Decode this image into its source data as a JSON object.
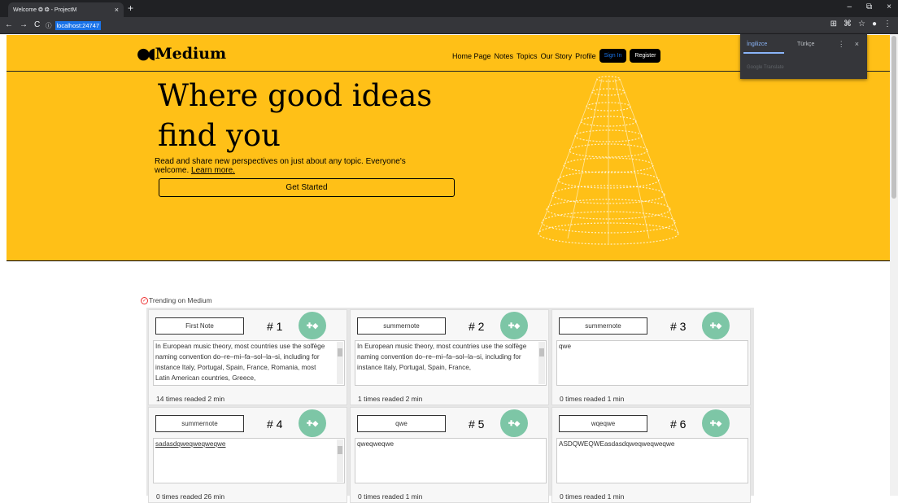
{
  "browser": {
    "tab_title": "Welcome ❂ ❂ - ProjectM",
    "tab_close": "×",
    "new_tab": "+",
    "url": "localhost:24747",
    "back": "←",
    "fwd": "→",
    "reload": "C",
    "info": "ⓘ",
    "min": "–",
    "restore": "⧉",
    "close": "×",
    "ext1": "⊞",
    "ext2": "⌘",
    "star": "☆",
    "profile": "●",
    "menu": "⋮"
  },
  "translate": {
    "lang_en": "İngilizce",
    "lang_tr": "Türkçe",
    "footer": "Google Translate",
    "more": "⋮",
    "close": "×"
  },
  "nav": {
    "brand": "Medium",
    "brand_mark": "●◖",
    "links": [
      "Home Page",
      "Notes",
      "Topics",
      "Our Story",
      "Profile"
    ],
    "signin": "Sign In",
    "register": "Register"
  },
  "hero": {
    "line1": "Where good ideas",
    "line2": "find you",
    "sub": "Read and share new perspectives on just about any topic. Everyone's welcome.",
    "learn": "Learn more.",
    "cta": "Get Started"
  },
  "trending": {
    "label": "Trending on Medium"
  },
  "cards": [
    {
      "title": "First Note",
      "rank": "# 1",
      "body": "In European music theory, most countries use the solfège naming convention do–re–mi–fa–sol–la–si, including for instance Italy, Portugal, Spain, France, Romania, most Latin American countries, Greece,",
      "foot": "14 times readed   2 min",
      "scroll": true
    },
    {
      "title": "summernote",
      "rank": "# 2",
      "body": "In European music theory, most countries use the solfège naming convention do–re–mi–fa–sol–la–si, including for instance Italy, Portugal, Spain, France,",
      "foot": "1 times readed   2 min",
      "scroll": true
    },
    {
      "title": "summernote",
      "rank": "# 3",
      "body": "qwe",
      "foot": "0 times readed   1 min",
      "scroll": false
    },
    {
      "title": "summernote",
      "rank": "# 4",
      "body": "sadasdqweqweqweqwe",
      "foot": "0 times readed   26 min",
      "scroll": true
    },
    {
      "title": "qwe",
      "rank": "# 5",
      "body": "qweqweqwe",
      "foot": "0 times readed   1 min",
      "scroll": false
    },
    {
      "title": "wqeqwe",
      "rank": "# 6",
      "body": "ASDQWEQWEasdasdqweqweqweqwe",
      "foot": "0 times readed   1 min",
      "scroll": false
    }
  ]
}
